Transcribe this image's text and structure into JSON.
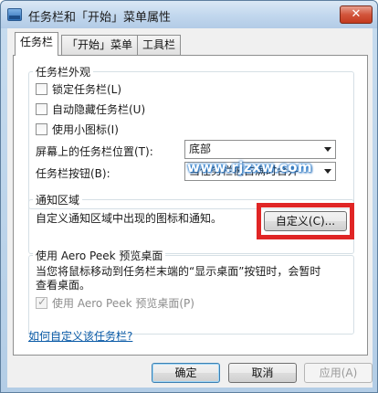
{
  "window": {
    "title": "任务栏和「开始」菜单属性",
    "close_glyph": "✕"
  },
  "tabs": [
    {
      "label": "任务栏",
      "active": true
    },
    {
      "label": "「开始」菜单",
      "active": false
    },
    {
      "label": "工具栏",
      "active": false
    }
  ],
  "appearance": {
    "title": "任务栏外观",
    "lock_label": "锁定任务栏(L)",
    "autohide_label": "自动隐藏任务栏(U)",
    "small_icons_label": "使用小图标(I)",
    "position_label": "屏幕上的任务栏位置(T):",
    "position_value": "底部",
    "buttons_label": "任务栏按钮(B):",
    "buttons_value": "当任务栏被占满时合并"
  },
  "notification": {
    "title": "通知区域",
    "description": "自定义通知区域中出现的图标和通知。",
    "customize_label": "自定义(C)..."
  },
  "aero": {
    "title": "使用 Aero Peek 预览桌面",
    "description_line1": "当您将鼠标移动到任务栏末端的“显示桌面”按钮时，会暂时",
    "description_line2": "查看桌面。",
    "checkbox_label": "使用 Aero Peek 预览桌面(P)"
  },
  "help_link": "如何自定义该任务栏?",
  "footer": {
    "ok_label": "确定",
    "cancel_label": "取消",
    "apply_label": "应用(A)"
  },
  "watermark": "www.rjzxw.com",
  "colors": {
    "highlight": "#e02525",
    "link": "#0b5ba7",
    "watermark_glow": "#2a7fd0"
  }
}
